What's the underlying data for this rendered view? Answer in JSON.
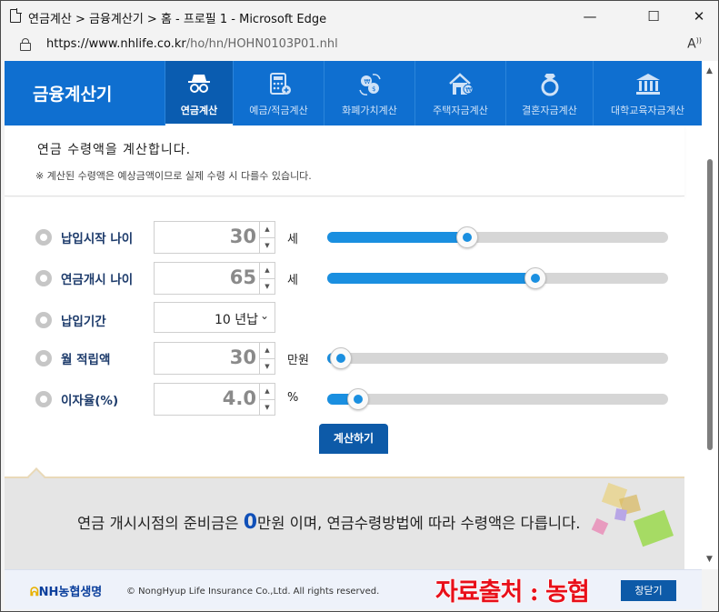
{
  "window": {
    "title": "연금계산 > 금융계산기 > 홈 - 프로필 1 - Microsoft Edge",
    "minimize": "—",
    "maximize": "☐",
    "close": "✕"
  },
  "address": {
    "host": "https://www.nhlife.co.kr",
    "path": "/ho/hn/HOHN0103P01.nhl",
    "reader_icon": "AA"
  },
  "nav": {
    "brand": "금융계산기",
    "tabs": [
      {
        "label": "연금계산",
        "icon": "spy-glasses-icon",
        "active": true
      },
      {
        "label": "예금/적금계산",
        "icon": "calculator-icon",
        "active": false
      },
      {
        "label": "화폐가치계산",
        "icon": "currency-exchange-icon",
        "active": false
      },
      {
        "label": "주택자금계산",
        "icon": "house-icon",
        "active": false
      },
      {
        "label": "결혼자금계산",
        "icon": "ring-icon",
        "active": false
      },
      {
        "label": "대학교육자금계산",
        "icon": "university-icon",
        "active": false
      }
    ]
  },
  "intro": {
    "heading": "연금 수령액을 계산합니다.",
    "note": "※ 계산된 수령액은 예상금액이므로 실제 수령 시 다를수 있습니다."
  },
  "form": {
    "start_age": {
      "label": "납입시작 나이",
      "value": "30",
      "unit": "세",
      "slider_fraction": 0.41
    },
    "pension_age": {
      "label": "연금개시 나이",
      "value": "65",
      "unit": "세",
      "slider_fraction": 0.61
    },
    "period": {
      "label": "납입기간",
      "value": "10 년납"
    },
    "monthly": {
      "label": "월 적립액",
      "value": "30",
      "unit": "만원",
      "slider_fraction": 0.04
    },
    "rate": {
      "label": "이자율(%)",
      "value": "4.0",
      "unit": "%",
      "slider_fraction": 0.09
    },
    "calc_button": "계산하기"
  },
  "result": {
    "prefix": "연금 개시시점의 준비금은 ",
    "amount": "0",
    "suffix": "만원 이며, 연금수령방법에 따라 수령액은 다릅니다."
  },
  "footer": {
    "logo_mark": "ᕱ",
    "logo_text": "NH농협생명",
    "copyright": "© NongHyup Life Insurance Co.,Ltd. All rights reserved.",
    "source_note": "자료출처 : 농협",
    "close_button": "창닫기"
  },
  "colors": {
    "nav_blue": "#0f6fd0",
    "accent_blue": "#1a8fe0",
    "button_blue": "#0d5aa8",
    "source_red": "#e8101a"
  }
}
